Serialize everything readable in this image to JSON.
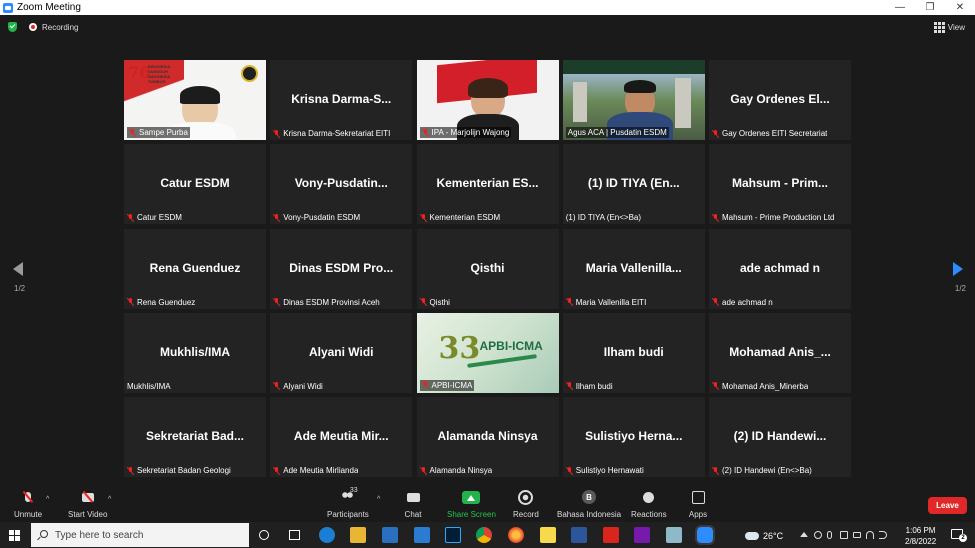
{
  "window": {
    "title": "Zoom Meeting",
    "minimize": "—",
    "restore": "❐",
    "close": "✕"
  },
  "topbar": {
    "recording": "Recording",
    "view": "View"
  },
  "participants": [
    {
      "label": "Sampe Purba",
      "video": true,
      "muted": true
    },
    {
      "name": "Krisna  Darma-S...",
      "label": "Krisna Darma-Sekretariat EITI",
      "muted": true
    },
    {
      "label": "IPA - Marjolijn Wajong",
      "video": true,
      "muted": true
    },
    {
      "label": "Agus ACA | Pusdatin ESDM",
      "video": true,
      "muted": false,
      "active": true
    },
    {
      "name": "Gay Ordenes El...",
      "label": "Gay Ordenes EITI Secretariat",
      "muted": true
    },
    {
      "name": "Catur ESDM",
      "label": "Catur ESDM",
      "muted": true
    },
    {
      "name": "Vony-Pusdatin...",
      "label": "Vony-Pusdatin ESDM",
      "muted": true
    },
    {
      "name": "Kementerian  ES...",
      "label": "Kementerian ESDM",
      "muted": true
    },
    {
      "name": "(1) ID  TIYA (En...",
      "label": "(1) ID  TIYA (En<>Ba)",
      "muted": false
    },
    {
      "name": "Mahsum - Prim...",
      "label": "Mahsum - Prime Production Ltd",
      "muted": true
    },
    {
      "name": "Rena Guenduez",
      "label": "Rena Guenduez",
      "muted": true
    },
    {
      "name": "Dinas ESDM Pro...",
      "label": "Dinas ESDM Provinsi Aceh",
      "muted": true
    },
    {
      "name": "Qisthi",
      "label": "Qisthi",
      "muted": true
    },
    {
      "name": "Maria Vallenilla...",
      "label": "Maria Vallenilla EITI",
      "muted": true
    },
    {
      "name": "ade achmad n",
      "label": "ade achmad n",
      "muted": true
    },
    {
      "name": "Mukhlis/IMA",
      "label": "Mukhlis/IMA",
      "muted": false
    },
    {
      "name": "Alyani Widi",
      "label": "Alyani Widi",
      "muted": true
    },
    {
      "label": "APBI-ICMA",
      "video": true,
      "muted": true
    },
    {
      "name": "Ilham budi",
      "label": "Ilham budi",
      "muted": true
    },
    {
      "name": "Mohamad Anis_...",
      "label": "Mohamad Anis_Minerba",
      "muted": true
    },
    {
      "name": "Sekretariat  Bad...",
      "label": "Sekretariat Badan Geologi",
      "muted": true
    },
    {
      "name": "Ade Meutia  Mir...",
      "label": "Ade Meutia Mirlianda",
      "muted": true
    },
    {
      "name": "Alamanda Ninsya",
      "label": "Alamanda Ninsya",
      "muted": true
    },
    {
      "name": "Sulistiyo  Herna...",
      "label": "Sulistiyo Hernawati",
      "muted": true
    },
    {
      "name": "(2) ID  Handewi...",
      "label": "(2) ID Handewi (En<>Ba)",
      "muted": true
    }
  ],
  "video_overlays": {
    "sampe_logo_num": "76",
    "sampe_logo_text": "INDONESIA TANGGUH INDONESIA TUMBUH",
    "apbi_num": "33",
    "apbi_text": "APBI-ICMA"
  },
  "paging": {
    "left": "1/2",
    "right": "1/2"
  },
  "toolbar": {
    "unmute": "Unmute",
    "start_video": "Start Video",
    "participants": "Participants",
    "participant_count": "33",
    "chat": "Chat",
    "share_screen": "Share Screen",
    "record": "Record",
    "language": "Bahasa Indonesia",
    "reactions": "Reactions",
    "apps": "Apps",
    "leave": "Leave",
    "caret": "^"
  },
  "taskbar": {
    "search_placeholder": "Type here to search",
    "weather": "26°C",
    "time": "1:06 PM",
    "date": "2/8/2022",
    "notifications": "2"
  },
  "colors": {
    "accent": "#2d8cff",
    "leave": "#e02828",
    "share": "#23b34a",
    "active_border": "#e3e37a"
  }
}
